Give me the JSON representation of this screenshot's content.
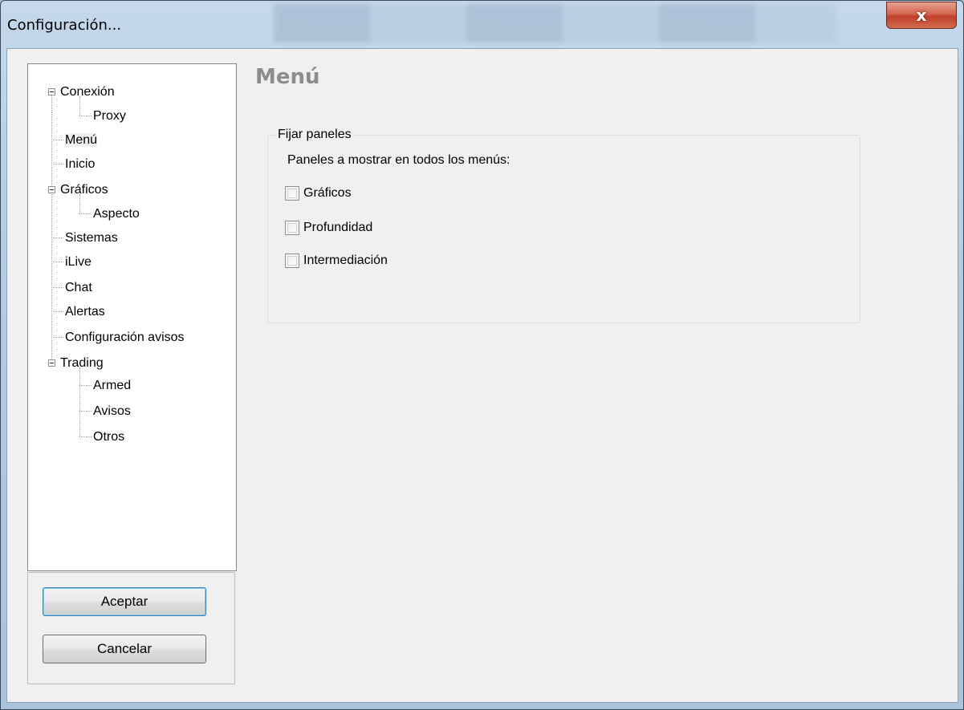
{
  "window": {
    "title": "Configuración...",
    "close_glyph": "x"
  },
  "tree": {
    "items": [
      {
        "label": "Conexión",
        "level": 0,
        "expanded": true
      },
      {
        "label": "Proxy",
        "level": 1
      },
      {
        "label": "Menú",
        "level": 0,
        "selected": true
      },
      {
        "label": "Inicio",
        "level": 0
      },
      {
        "label": "Gráficos",
        "level": 0,
        "expanded": true
      },
      {
        "label": "Aspecto",
        "level": 1
      },
      {
        "label": "Sistemas",
        "level": 0
      },
      {
        "label": "iLive",
        "level": 0
      },
      {
        "label": "Chat",
        "level": 0
      },
      {
        "label": "Alertas",
        "level": 0
      },
      {
        "label": "Configuración avisos",
        "level": 0
      },
      {
        "label": "Trading",
        "level": 0,
        "expanded": true
      },
      {
        "label": "Armed",
        "level": 1
      },
      {
        "label": "Avisos",
        "level": 1
      },
      {
        "label": "Otros",
        "level": 1
      }
    ]
  },
  "buttons": {
    "accept": "Aceptar",
    "cancel": "Cancelar"
  },
  "page": {
    "heading": "Menú",
    "group": {
      "legend": "Fijar paneles",
      "description": "Paneles a mostrar en todos los menús:",
      "options": [
        {
          "label": "Gráficos",
          "checked": false
        },
        {
          "label": "Profundidad",
          "checked": false
        },
        {
          "label": "Intermediación",
          "checked": false
        }
      ]
    }
  },
  "colors": {
    "heading": "#8c8c8c",
    "close_button": "#c0402a",
    "default_button_border": "#3c7fb1"
  }
}
